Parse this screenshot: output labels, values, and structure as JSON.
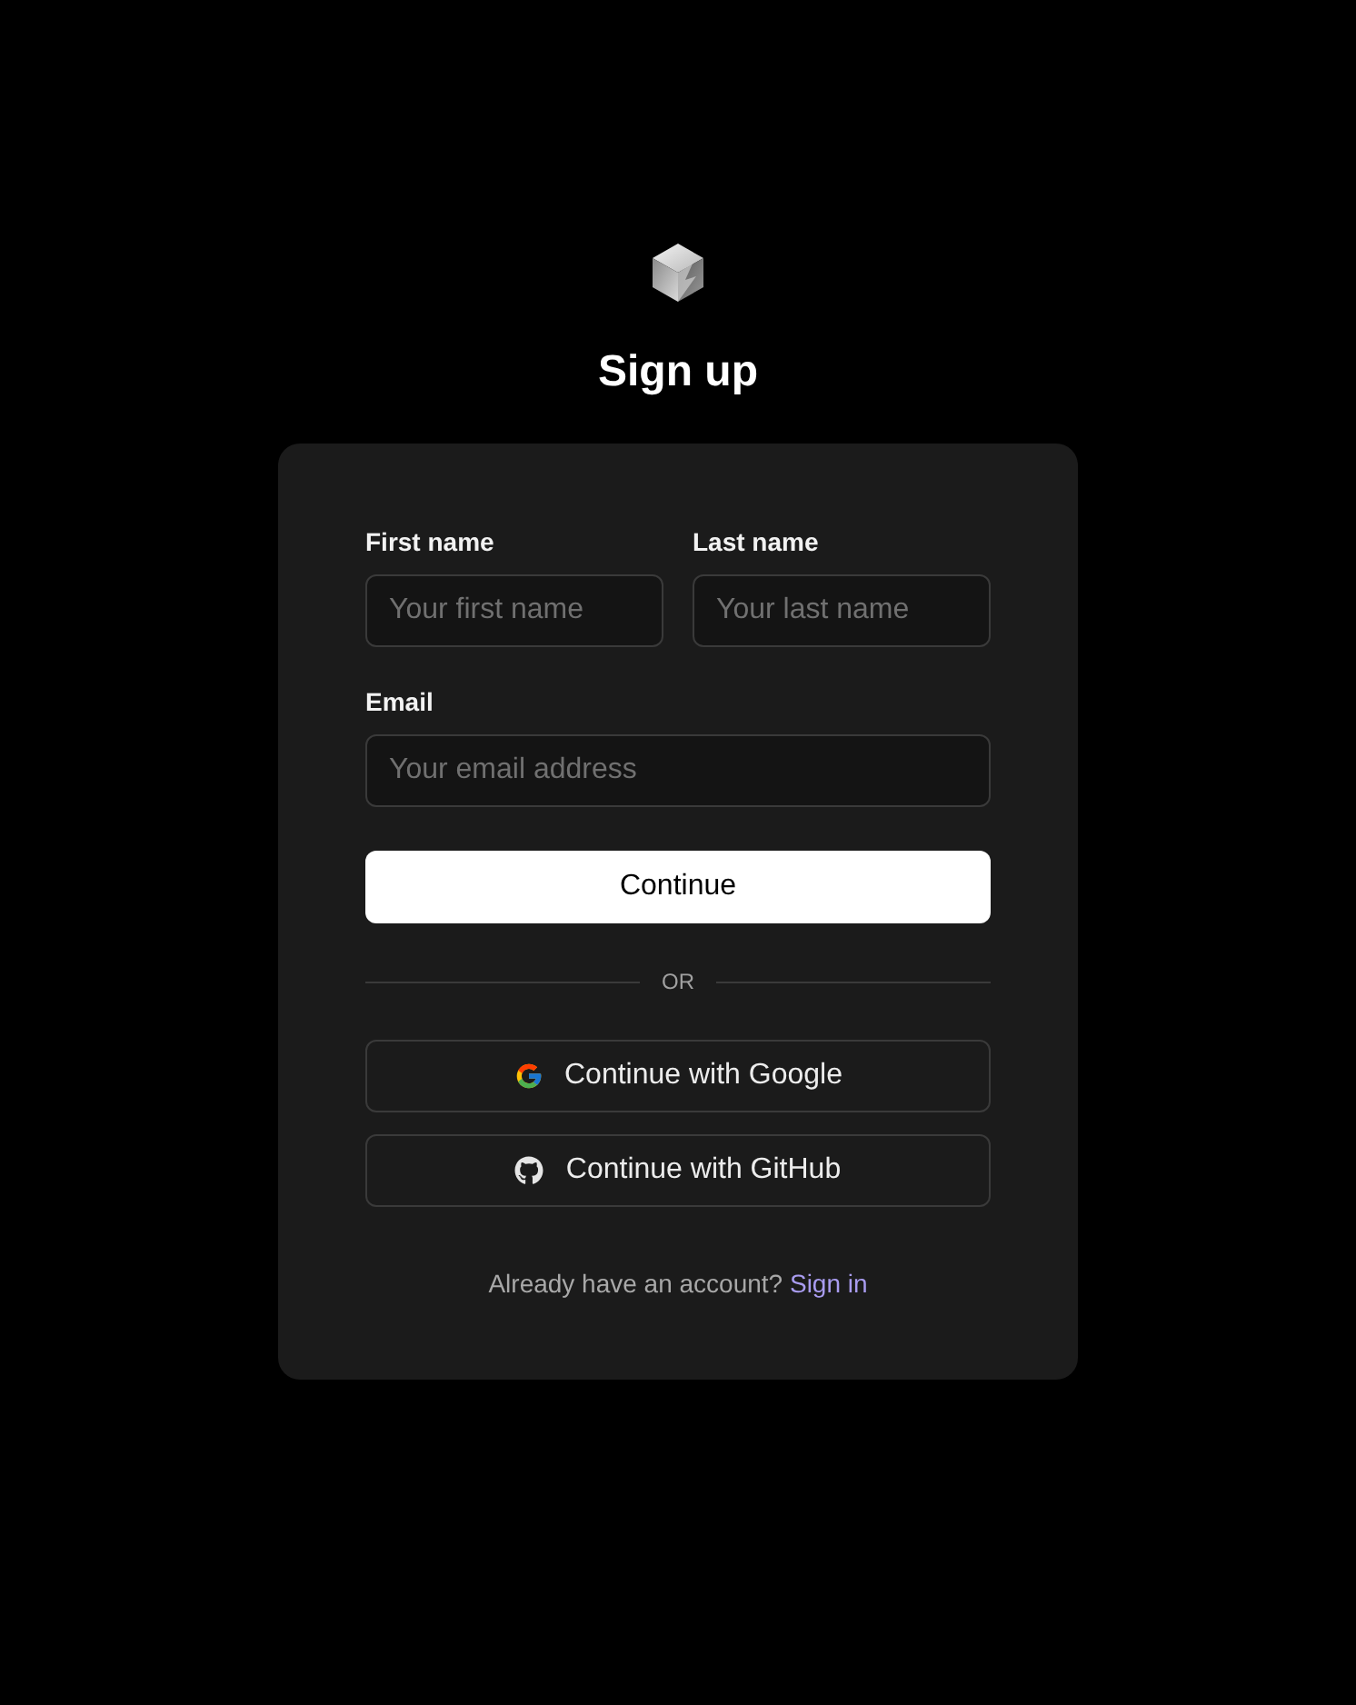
{
  "title": "Sign up",
  "form": {
    "rows": [
      {
        "fields": [
          {
            "label": "First name",
            "placeholder": "Your first name"
          },
          {
            "label": "Last name",
            "placeholder": "Your last name"
          }
        ]
      },
      {
        "fields": [
          {
            "label": "Email",
            "placeholder": "Your email address"
          }
        ]
      }
    ],
    "submit": "Continue",
    "divider": "OR",
    "social_buttons": [
      {
        "kind": "google",
        "label": "Continue with Google"
      },
      {
        "kind": "github",
        "label": "Continue with GitHub"
      }
    ],
    "footer": {
      "text": "Already have an account?",
      "link": "Sign in"
    }
  }
}
